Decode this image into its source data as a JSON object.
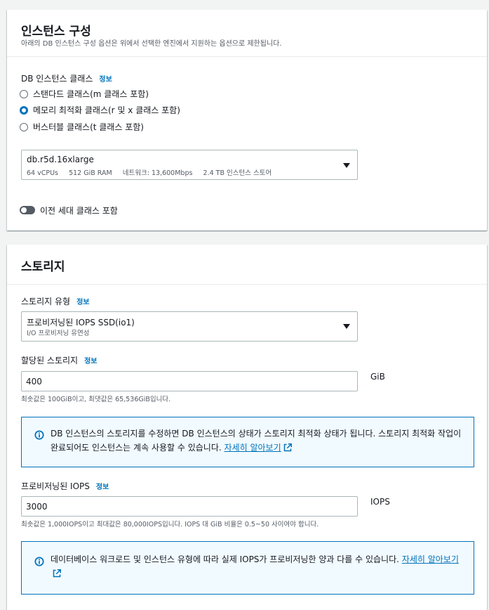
{
  "instance_panel": {
    "title": "인스턴스 구성",
    "description": "아래의 DB 인스턴스 구성 옵션은 위에서 선택한 엔진에서 지원하는 옵션으로 제한됩니다.",
    "class_label": "DB 인스턴스 클래스",
    "info": "정보",
    "radios": [
      {
        "label": "스탠다드 클래스(m 클래스 포함)",
        "selected": false
      },
      {
        "label": "메모리 최적화 클래스(r 및 x 클래스 포함)",
        "selected": true
      },
      {
        "label": "버스터블 클래스(t 클래스 포함)",
        "selected": false
      }
    ],
    "instance_select": {
      "value": "db.r5d.16xlarge",
      "details": "64 vCPUs     512 GiB RAM     네트워크: 13,600Mbps     2.4 TB 인스턴스 스토어"
    },
    "toggle": {
      "label": "이전 세대 클래스 포함",
      "on": false
    }
  },
  "storage_panel": {
    "title": "스토리지",
    "type_label": "스토리지 유형",
    "info": "정보",
    "type_select": {
      "value": "프로비저닝된 IOPS SSD(io1)",
      "details": "I/O 프로비저닝 유연성"
    },
    "allocated_label": "할당된 스토리지",
    "allocated_value": "400",
    "allocated_unit": "GiB",
    "allocated_hint": "최솟값은 100GiB이고, 최댓값은 65,536GiB입니다.",
    "storage_alert": {
      "text": "DB 인스턴스의 스토리지를 수정하면 DB 인스턴스의 상태가 스토리지 최적화 상태가 됩니다. 스토리지 최적화 작업이 완료되어도 인스턴스는 계속 사용할 수 있습니다.",
      "link": "자세히 알아보기"
    },
    "iops_label": "프로비저닝된 IOPS",
    "iops_value": "3000",
    "iops_unit": "IOPS",
    "iops_hint": "최솟값은 1,000IOPS이고 최대값은 80,000IOPS입니다. IOPS 대 GiB 비율은 0.5~50 사이여야 합니다.",
    "iops_alert": {
      "text": "데이터베이스 워크로드 및 인스턴스 유형에 따라 실제 IOPS가 프로비저닝한 양과 다를 수 있습니다.",
      "link": "자세히 알아보기"
    }
  },
  "colors": {
    "accent": "#0073bb",
    "alert_bg": "#f1faff",
    "page_bg": "#f2f3f3"
  }
}
